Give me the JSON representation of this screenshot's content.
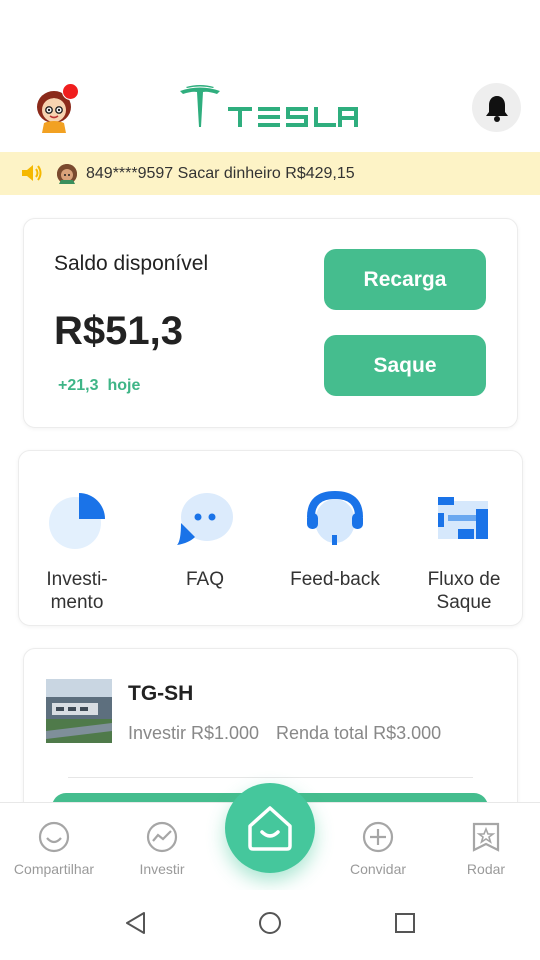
{
  "header": {
    "brand": "TESLA",
    "avatar_icon": "cartoon-girl-avatar",
    "notification_icon": "bell-icon"
  },
  "ticker": {
    "message": "849****9597 Sacar dinheiro R$429,15"
  },
  "balance": {
    "label": "Saldo disponível",
    "value": "R$51,3",
    "delta": "+21,3",
    "delta_suffix": "hoje",
    "recharge_label": "Recarga",
    "withdraw_label": "Saque"
  },
  "menu": [
    {
      "label": "Investi-\nmento",
      "icon": "pie-chart-icon"
    },
    {
      "label": "FAQ",
      "icon": "chat-bubble-icon"
    },
    {
      "label": "Feed-back",
      "icon": "headset-icon"
    },
    {
      "label": "Fluxo de\nSaque",
      "icon": "flow-icon"
    }
  ],
  "product": {
    "name": "TG-SH",
    "invest": "Investir R$1.000",
    "total": "Renda total R$3.000"
  },
  "nav": [
    {
      "label": "Compartilhar",
      "icon": "smile-icon"
    },
    {
      "label": "Investir",
      "icon": "trend-icon"
    },
    {
      "label": "",
      "icon": "home-icon"
    },
    {
      "label": "Convidar",
      "icon": "plus-circle-icon"
    },
    {
      "label": "Rodar",
      "icon": "star-badge-icon"
    }
  ],
  "colors": {
    "accent": "#45bd8e",
    "ticker_bg": "#fdf3c6",
    "logo": "#2fae7e",
    "icon_blue": "#1a73e8"
  }
}
